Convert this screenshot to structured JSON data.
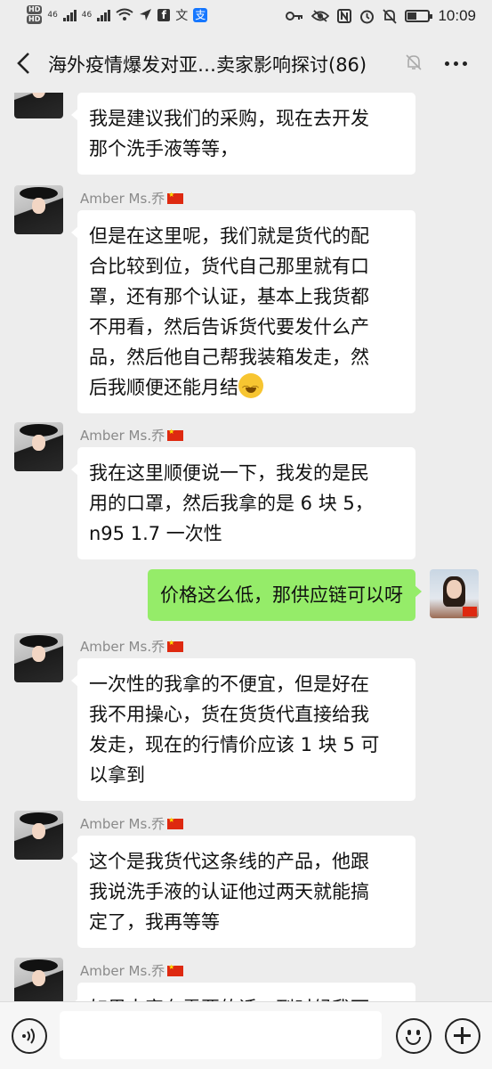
{
  "status_bar": {
    "network_labels": [
      "HD",
      "HD",
      "46",
      "46"
    ],
    "time": "10:09",
    "battery_level": 0.45,
    "icons": [
      "signal-icon",
      "wifi-icon",
      "location-icon",
      "facebook-icon",
      "translate-icon",
      "alipay-icon",
      "key-icon",
      "eye-icon",
      "nfc-icon",
      "alarm-icon",
      "mute-icon",
      "battery-icon"
    ]
  },
  "header": {
    "title": "海外疫情爆发对亚…卖家影响探讨(86)",
    "back_icon": "back-arrow-icon",
    "mute_icon": "bell-muted-icon",
    "more_icon": "more-dots-icon"
  },
  "messages": [
    {
      "from": "other",
      "sender": "",
      "text_lines": [
        "我是建议我们的采购，现在去开发",
        "那个洗手液等等，"
      ]
    },
    {
      "from": "other",
      "sender": "Amber Ms.乔",
      "text_lines": [
        "但是在这里呢，我们就是货代的配",
        "合比较到位，货代自己那里就有口",
        "罩，还有那个认证，基本上我货都",
        "不用看，然后告诉货代要发什么产",
        "品，然后他自己帮我装箱发走，然",
        "后我顺便还能月结"
      ],
      "trailing_emoji": "laugh-cry-emoji"
    },
    {
      "from": "other",
      "sender": "Amber Ms.乔",
      "text_lines": [
        "我在这里顺便说一下，我发的是民",
        "用的口罩，然后我拿的是 6 块 5，",
        "n95 1.7 一次性"
      ]
    },
    {
      "from": "me",
      "sender": "",
      "text_lines": [
        "价格这么低，那供应链可以呀"
      ]
    },
    {
      "from": "other",
      "sender": "Amber Ms.乔",
      "text_lines": [
        "一次性的我拿的不便宜，但是好在",
        "我不用操心，货在货货代直接给我",
        "发走，现在的行情价应该 1 块 5 可",
        "以拿到"
      ]
    },
    {
      "from": "other",
      "sender": "Amber Ms.乔",
      "text_lines": [
        "这个是我货代这条线的产品，他跟",
        "我说洗手液的认证他过两天就能搞",
        "定了，我再等等"
      ]
    },
    {
      "from": "other",
      "sender": "Amber Ms.乔",
      "text_lines": [
        "如果大家有需要的话，到时候我可"
      ]
    }
  ],
  "input_bar": {
    "placeholder": "",
    "voice_icon": "voice-icon",
    "emoji_icon": "emoji-icon",
    "plus_icon": "plus-icon"
  }
}
